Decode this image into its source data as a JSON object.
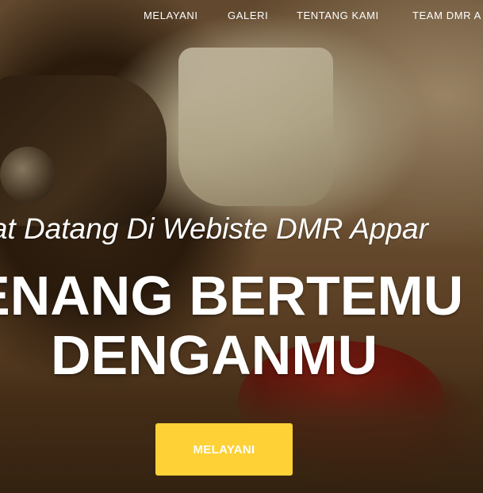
{
  "nav": {
    "items": [
      {
        "label": "MELAYANI"
      },
      {
        "label": "GALERI"
      },
      {
        "label": "TENTANG KAMI"
      },
      {
        "label": "TEAM DMR A"
      }
    ]
  },
  "hero": {
    "subheading": "mat Datang Di Webiste DMR Appar",
    "headline_line1": "ENANG BERTEMU",
    "headline_line2": "DENGANMU",
    "cta_label": "MELAYANI"
  },
  "colors": {
    "accent": "#fed136",
    "text": "#ffffff"
  }
}
